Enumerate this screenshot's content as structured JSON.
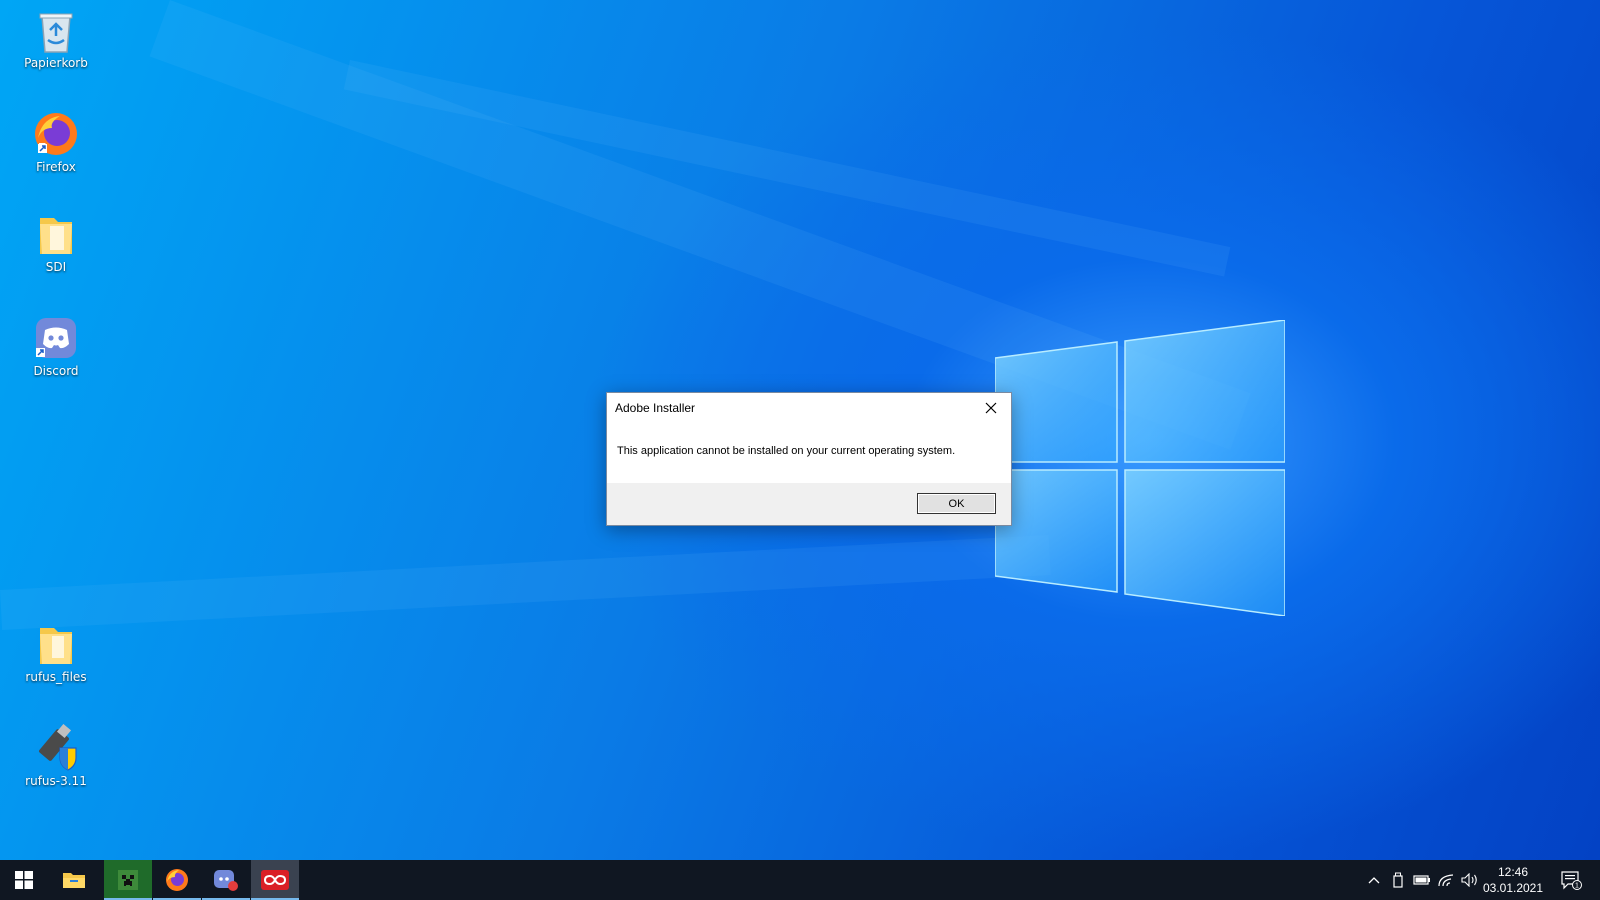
{
  "desktop": {
    "icons": [
      {
        "label": "Papierkorb",
        "icon": "recycle-bin-icon"
      },
      {
        "label": "Firefox",
        "icon": "firefox-icon"
      },
      {
        "label": "SDI",
        "icon": "folder-icon"
      },
      {
        "label": "Discord",
        "icon": "discord-icon"
      },
      {
        "label": "rufus_files",
        "icon": "folder-icon"
      },
      {
        "label": "rufus-3.11",
        "icon": "rufus-usb-icon"
      }
    ]
  },
  "dialog": {
    "title": "Adobe Installer",
    "message": "This application cannot be installed on your current operating system.",
    "ok_label": "OK",
    "close_icon": "close-icon"
  },
  "taskbar": {
    "apps": [
      {
        "icon": "start-windows-icon"
      },
      {
        "icon": "file-explorer-icon"
      },
      {
        "icon": "minecraft-app-icon"
      },
      {
        "icon": "firefox-icon"
      },
      {
        "icon": "discord-app-icon"
      },
      {
        "icon": "adobe-creative-cloud-icon"
      }
    ],
    "tray": {
      "icons": [
        "chevron-up-icon",
        "usb-drive-icon",
        "battery-icon",
        "wifi-icon",
        "volume-icon"
      ],
      "time": "12:46",
      "date": "03.01.2021",
      "notification_count": "1"
    }
  },
  "colors": {
    "taskbar_bg": "#101722",
    "desktop_accent": "#0a7be6",
    "active_indicator": "#76b9ed"
  }
}
